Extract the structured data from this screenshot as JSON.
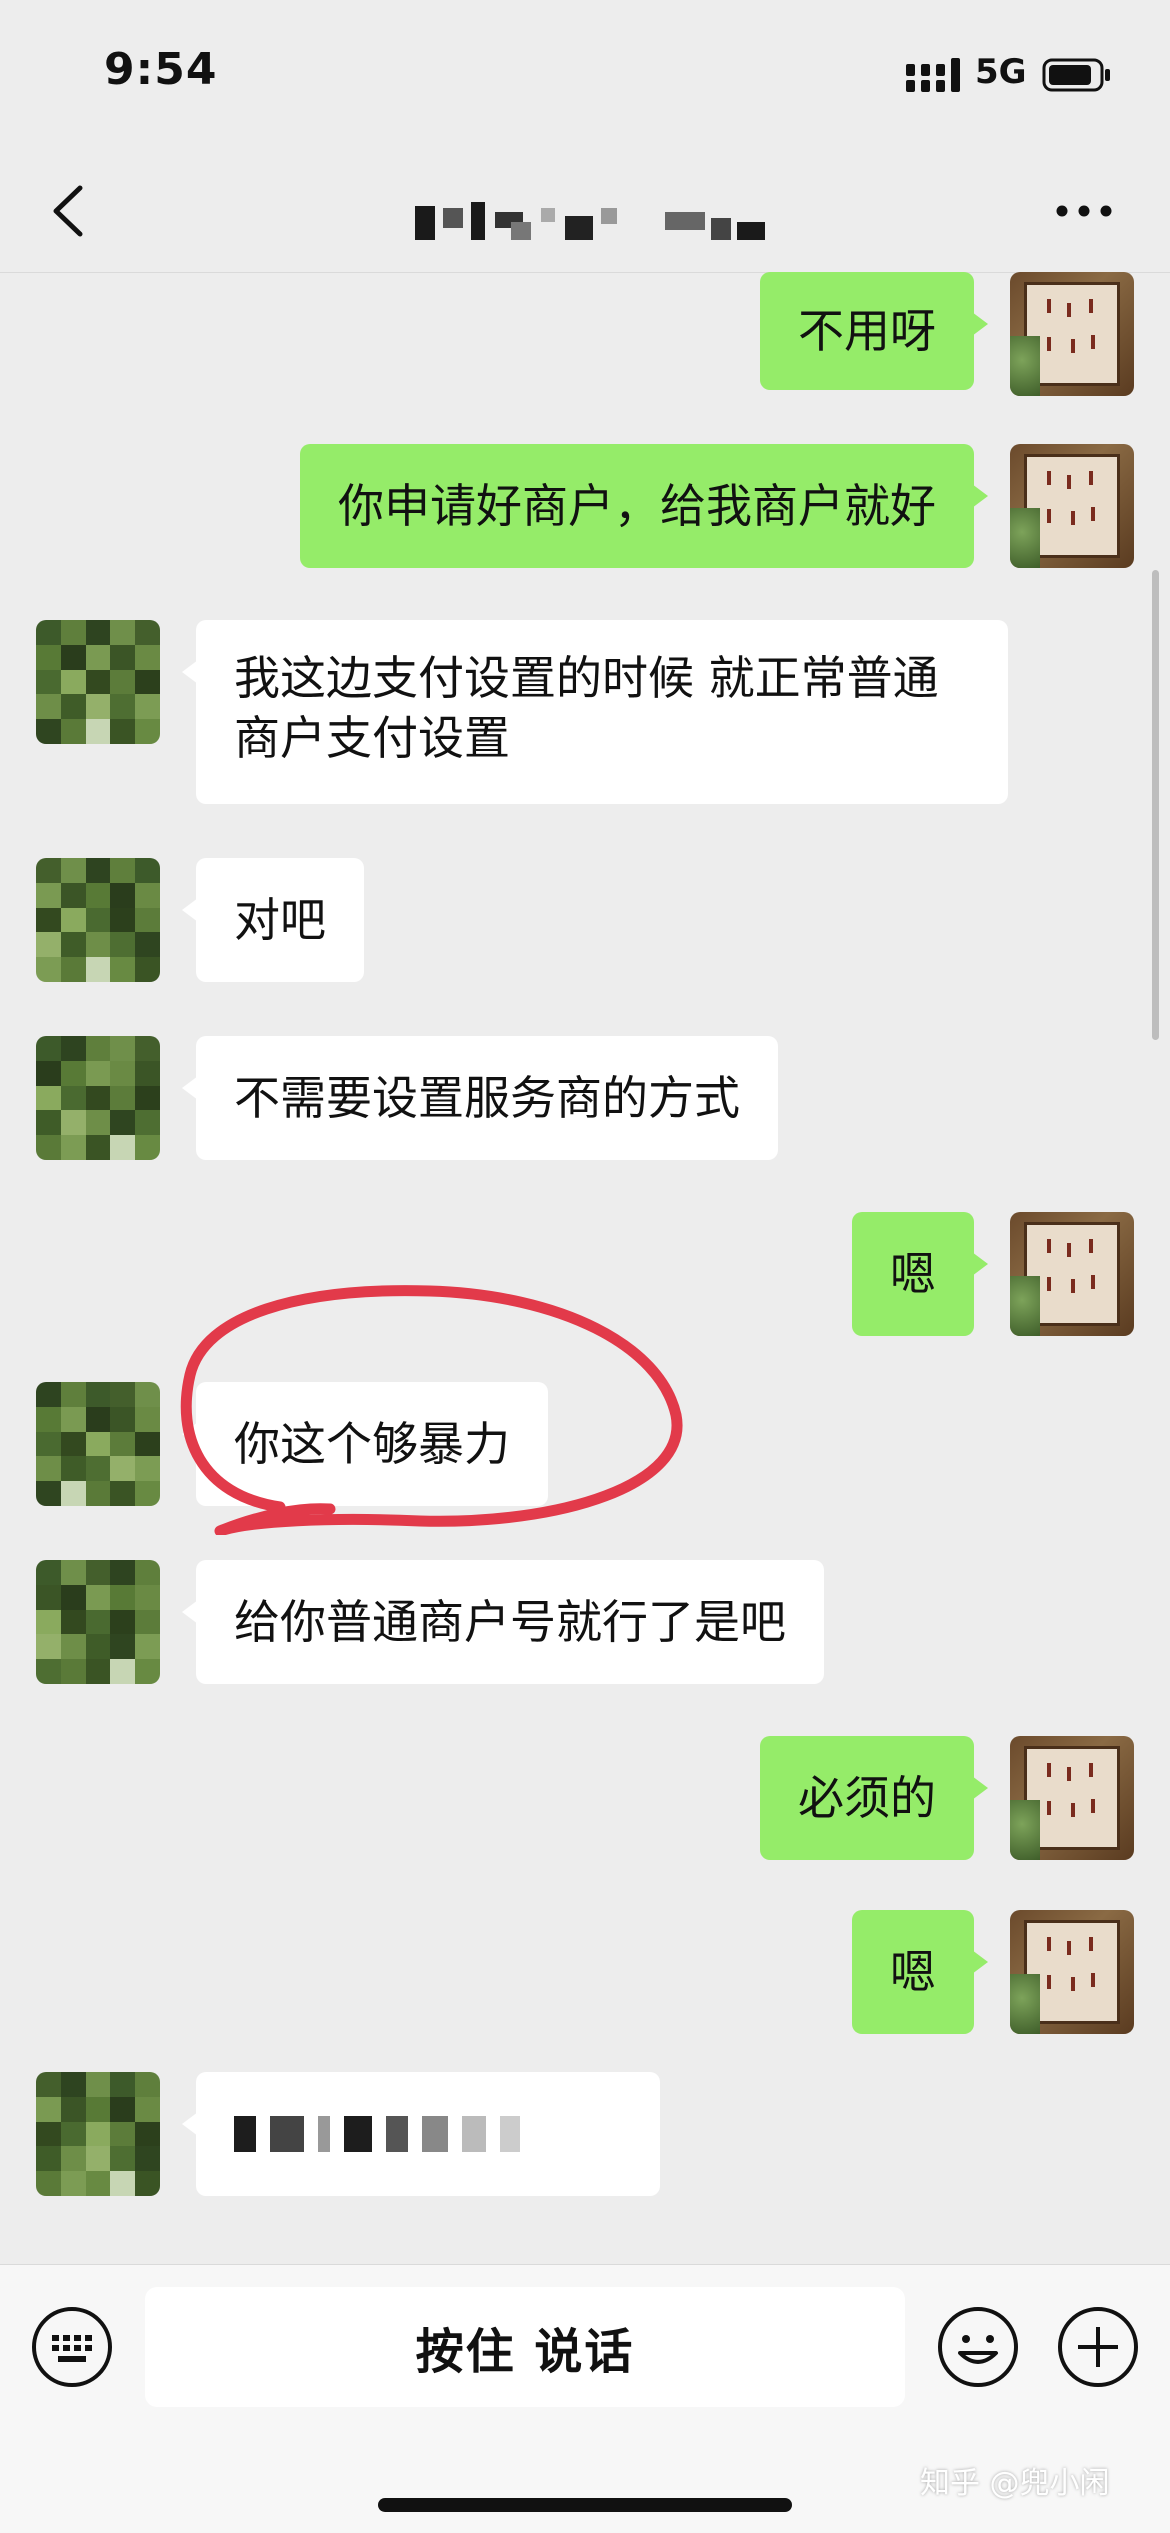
{
  "status": {
    "time": "9:54",
    "network": "5G"
  },
  "nav": {
    "back": "back",
    "more": "more"
  },
  "messages": [
    {
      "side": "me",
      "text": "不用呀"
    },
    {
      "side": "me",
      "text": "你申请好商户，给我商户就好"
    },
    {
      "side": "other",
      "text": "我这边支付设置的时候 就正常普通商户支付设置"
    },
    {
      "side": "other",
      "text": "对吧"
    },
    {
      "side": "other",
      "text": "不需要设置服务商的方式"
    },
    {
      "side": "me",
      "text": "嗯"
    },
    {
      "side": "other",
      "text": "你这个够暴力",
      "annotated": true
    },
    {
      "side": "other",
      "text": "给你普通商户号就行了是吧"
    },
    {
      "side": "me",
      "text": "必须的"
    },
    {
      "side": "me",
      "text": "嗯"
    },
    {
      "side": "other",
      "text": "",
      "redacted": true
    }
  ],
  "input": {
    "voice_label": "按住 说话"
  },
  "watermark": "知乎 @兜小闲",
  "colors": {
    "background": "#ededed",
    "my_bubble": "#95ec69",
    "their_bubble": "#ffffff",
    "annotation": "#e23a4a"
  },
  "icons": [
    "chevron-left-icon",
    "more-dots-icon",
    "keyboard-icon",
    "emoji-icon",
    "plus-icon",
    "signal-icon",
    "battery-icon"
  ]
}
